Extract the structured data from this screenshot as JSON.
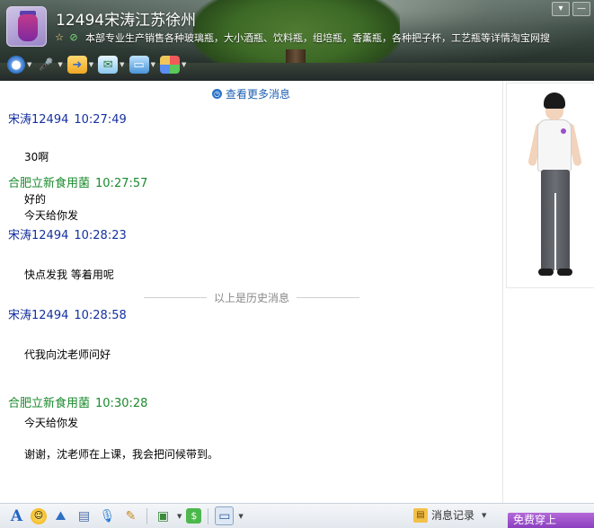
{
  "header": {
    "contact_name": "12494宋涛江苏徐州",
    "signature": "本部专业生产销售各种玻璃瓶，大小酒瓶、饮料瓶，组培瓶，香薰瓶，各种把子杯，工艺瓶等详情淘宝网搜"
  },
  "chat": {
    "more_messages": "查看更多消息",
    "history_divider": "以上是历史消息",
    "messages": [
      {
        "sender": "宋涛12494",
        "time": "10:27:49",
        "lines": [
          "30啊"
        ]
      },
      {
        "sender": "合肥立新食用菌",
        "time": "10:27:57",
        "lines": [
          "好的",
          "今天给你发"
        ]
      },
      {
        "sender": "宋涛12494",
        "time": "10:28:23",
        "lines": [
          "快点发我 等着用呢"
        ]
      },
      {
        "sender": "宋涛12494",
        "time": "10:28:58",
        "lines": [
          "代我向沈老师问好"
        ]
      },
      {
        "sender": "合肥立新食用菌",
        "time": "10:30:28",
        "lines": [
          "今天给你发",
          "谢谢，沈老师在上课，我会把问候带到。"
        ]
      }
    ]
  },
  "bottom": {
    "record_label": "消息记录",
    "free_wear_label": "免费穿上"
  },
  "colors": {
    "self_name": "#1530a0",
    "other_name": "#1a8a2c",
    "link": "#1d5fb0",
    "free_wear": "#8a3fbf"
  },
  "icons": {
    "window": [
      "menu-icon",
      "minimize-icon"
    ],
    "top_toolbar": [
      "video-call-icon",
      "voice-call-icon",
      "file-transfer-icon",
      "sms-icon",
      "remote-desktop-icon",
      "app-box-icon"
    ],
    "bottom_toolbar": [
      "font-icon",
      "emoji-icon",
      "nudge-icon",
      "music-icon",
      "voice-message-icon",
      "scratch-pad-icon",
      "image-icon",
      "sticker-icon",
      "screenshot-icon"
    ]
  }
}
